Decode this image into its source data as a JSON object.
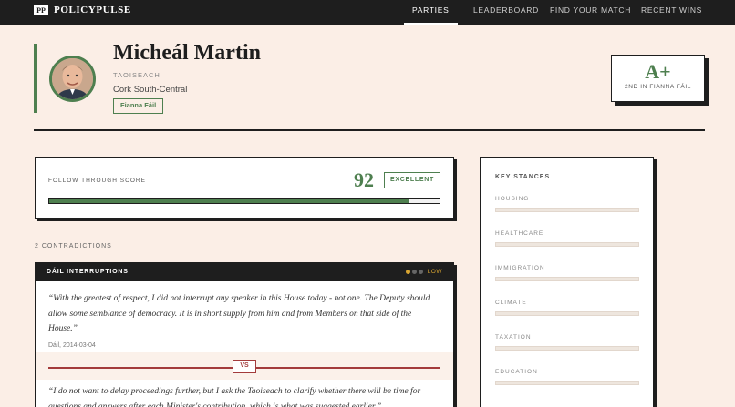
{
  "brand": {
    "mark": "PP",
    "name": "POLICYPULSE"
  },
  "nav": [
    "PARTIES",
    "LEADERBOARD",
    "FIND YOUR MATCH",
    "RECENT WINS"
  ],
  "nav_active": "PARTIES",
  "politician": {
    "name": "Micheál Martin",
    "role": "TAOISEACH",
    "constituency": "Cork South-Central",
    "party": "Fianna Fáil"
  },
  "grade": {
    "letter": "A+",
    "rank": "2ND IN FIANNA FÁIL"
  },
  "follow_through": {
    "label": "FOLLOW THROUGH SCORE",
    "score": "92",
    "rating": "EXCELLENT",
    "fraction": 0.92
  },
  "contradictions": {
    "count_label": "2 CONTRADICTIONS",
    "items": [
      {
        "topic": "DÁIL INTERRUPTIONS",
        "severity": "LOW",
        "severity_level": 1,
        "quote_a": "“With the greatest of respect, I did not interrupt any speaker in this House today - not one. The Deputy should allow some semblance of democracy. It is in short supply from him and from Members on that side of the House.”",
        "meta_a": "Dáil, 2014-03-04",
        "vs": "VS",
        "quote_b": "“I do not want to delay proceedings further, but I ask the Taoiseach to clarify whether there will be time for questions and answers after each Minister's contribution, which is what was suggested earlier.”"
      }
    ]
  },
  "stances": {
    "title": "KEY STANCES",
    "items": [
      {
        "label": "HOUSING"
      },
      {
        "label": "HEALTHCARE"
      },
      {
        "label": "IMMIGRATION"
      },
      {
        "label": "CLIMATE"
      },
      {
        "label": "TAXATION"
      },
      {
        "label": "EDUCATION"
      }
    ]
  },
  "colors": {
    "accent": "#4e7f4f",
    "dark": "#1e1e1e",
    "background": "#fbeee6",
    "warning": "#d8a531",
    "contrast": "#a33b3b"
  }
}
